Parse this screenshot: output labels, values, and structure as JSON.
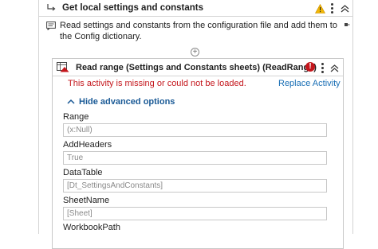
{
  "sequence": {
    "title": "Get local settings and constants",
    "warning_icon": "warning-icon",
    "annotation": "Read settings and constants from the configuration file and add them to the Config dictionary."
  },
  "activity": {
    "title": "Read range (Settings and Constants sheets) (ReadRange)",
    "error_badge": "!",
    "missing_message": "This activity is missing or could not be loaded.",
    "replace_label": "Replace Activity",
    "hide_advanced_label": "Hide advanced options",
    "properties": [
      {
        "label": "Range",
        "value": "(x:Null)"
      },
      {
        "label": "AddHeaders",
        "value": "True"
      },
      {
        "label": "DataTable",
        "value": "[Dt_SettingsAndConstants]"
      },
      {
        "label": "SheetName",
        "value": "[Sheet]"
      },
      {
        "label": "WorkbookPath",
        "value": ""
      }
    ]
  },
  "colors": {
    "error": "#c4161c",
    "link": "#1a6fb5",
    "warning": "#f2b705"
  }
}
